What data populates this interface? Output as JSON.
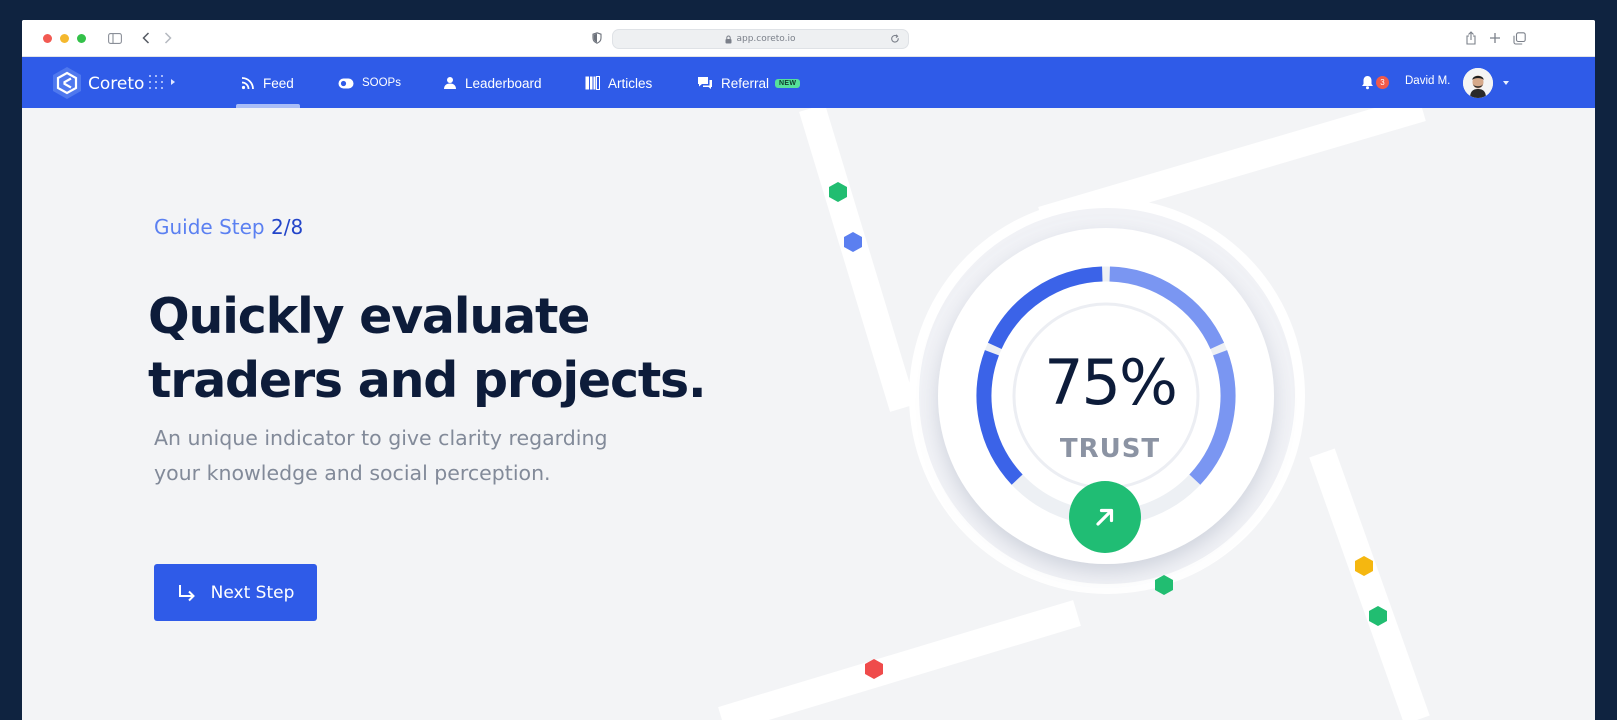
{
  "browser": {
    "url": "app.coreto.io"
  },
  "nav": {
    "brand": "Coreto",
    "items": [
      {
        "label": "Feed",
        "icon": "rss-icon",
        "active": true
      },
      {
        "label": "SOOPs",
        "icon": "toggle-icon"
      },
      {
        "label": "Leaderboard",
        "icon": "user-icon"
      },
      {
        "label": "Articles",
        "icon": "articles-icon"
      },
      {
        "label": "Referral",
        "icon": "chat-icon",
        "badge": "NEW"
      }
    ],
    "notifications": "3",
    "user": "David M."
  },
  "guide": {
    "step_label": "Guide Step",
    "step_value": "2/8",
    "headline_line1": "Quickly evaluate",
    "headline_line2": "traders and projects.",
    "subtext_line1": "An unique indicator to give clarity regarding",
    "subtext_line2": "your knowledge and social perception.",
    "next_label": "Next Step"
  },
  "gauge": {
    "value_text": "75%",
    "value_fraction": 0.75,
    "label": "TRUST"
  },
  "colors": {
    "brand_blue": "#2f5be8",
    "navy_text": "#0d1c3a",
    "gray_text": "#828a99",
    "green": "#20bd74",
    "gauge_light": "#7a96f2",
    "gauge_dark": "#3b63e8"
  }
}
